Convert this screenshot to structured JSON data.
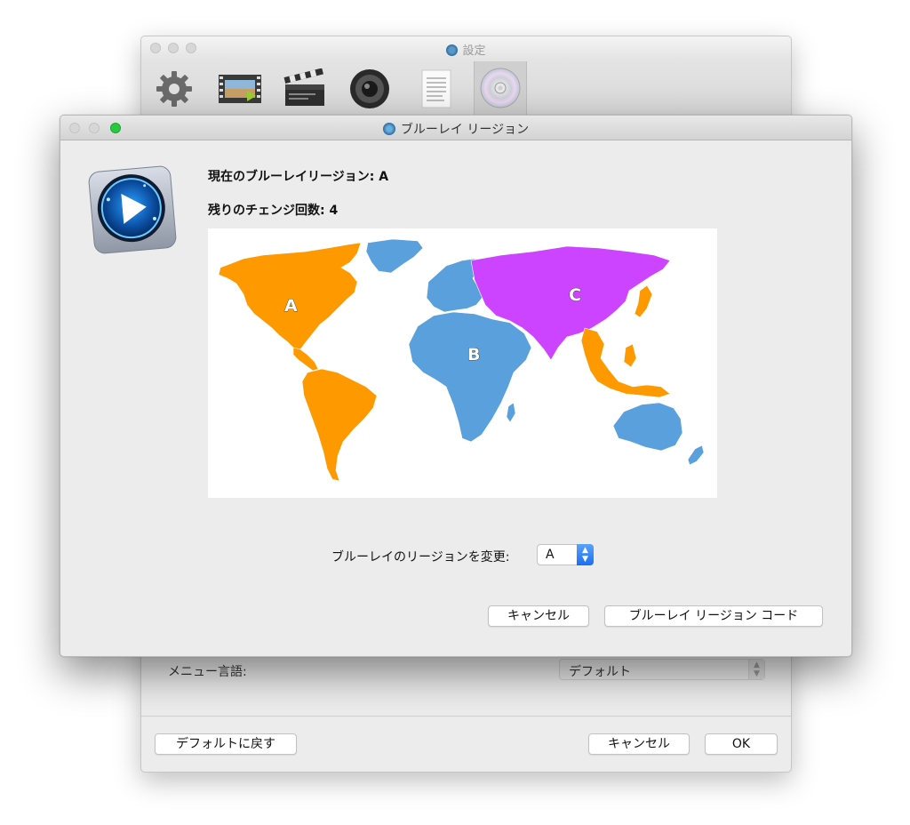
{
  "background_window": {
    "title": "設定",
    "toolbar": [
      {
        "icon": "gear-icon"
      },
      {
        "icon": "video-icon"
      },
      {
        "icon": "clapperboard-icon"
      },
      {
        "icon": "speaker-icon"
      },
      {
        "icon": "document-icon"
      },
      {
        "icon": "disc-icon",
        "selected": true
      }
    ],
    "menu_language_label": "メニュー言語:",
    "menu_language_value": "デフォルト",
    "restore_default_label": "デフォルトに戻す",
    "cancel_label": "キャンセル",
    "ok_label": "OK"
  },
  "dialog": {
    "title": "ブルーレイ リージョン",
    "current_region_line": "現在のブルーレイリージョン: A",
    "remaining_changes_line": "残りのチェンジ回数: 4",
    "map": {
      "regions": [
        {
          "label": "A",
          "color": "#ff9900"
        },
        {
          "label": "B",
          "color": "#5aa0dc"
        },
        {
          "label": "C",
          "color": "#cc44ff"
        }
      ]
    },
    "change_region_label": "ブルーレイのリージョンを変更:",
    "region_select_value": "A",
    "cancel_label": "キャンセル",
    "region_code_label": "ブルーレイ リージョン コード"
  }
}
